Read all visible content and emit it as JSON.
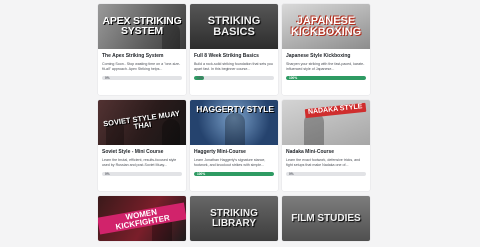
{
  "courses": [
    {
      "thumb_text": "Apex Striking System",
      "thumb_style": "t-apex",
      "title": "The Apex Striking System",
      "description": "Coming Soon.. Stop wasting time on a \"one-size-fit-all\" approach. Apex Striking helps...",
      "progress_percent": 0,
      "progress_label": "0%"
    },
    {
      "thumb_text": "Striking Basics",
      "thumb_style": "t-basics",
      "title": "Full 8 Week Striking Basics",
      "description": "Build a rock-solid striking foundation that sets you apart fast. In this beginner course...",
      "progress_percent": 13,
      "progress_label": "13%"
    },
    {
      "thumb_text": "Japanese Kickboxing",
      "thumb_style": "t-kick",
      "title": "Japanese Style Kickboxing",
      "description": "Sharpen your striking with the fast-paced, karate-influenced style of Japanese...",
      "progress_percent": 100,
      "progress_label": "100%"
    },
    {
      "thumb_text": "Soviet Style Muay Thai",
      "thumb_style": "t-soviet",
      "title": "Soviet Style - Mini Course",
      "description": "Learn the brutal, efficient, results-focused style used by Russian and post-Soviet Muay...",
      "progress_percent": 0,
      "progress_label": "0%"
    },
    {
      "thumb_text": "Haggerty Style",
      "thumb_style": "t-hag",
      "title": "Haggerty Mini-Course",
      "description": "Learn Jonathan Haggerty's signature stance, footwork, and knockout strikes with simple...",
      "progress_percent": 100,
      "progress_label": "100%"
    },
    {
      "thumb_text": "Nadaka Style",
      "thumb_style": "t-nad",
      "title": "Nadaka Mini-Course",
      "description": "Learn the exact footwork, defensive tricks, and fight setups that make Nadaka one of...",
      "progress_percent": 0,
      "progress_label": "0%"
    },
    {
      "thumb_text": "Women Kickfighter",
      "thumb_style": "t-women",
      "row3": true
    },
    {
      "thumb_text": "Striking Library",
      "thumb_style": "t-lib",
      "row3": true
    },
    {
      "thumb_text": "Film Studies",
      "thumb_style": "t-film",
      "row3": true
    }
  ],
  "colors": {
    "progress_fill": "#2e9b63",
    "progress_track": "#e2e3e6",
    "page_bg": "#f4f4f5"
  }
}
